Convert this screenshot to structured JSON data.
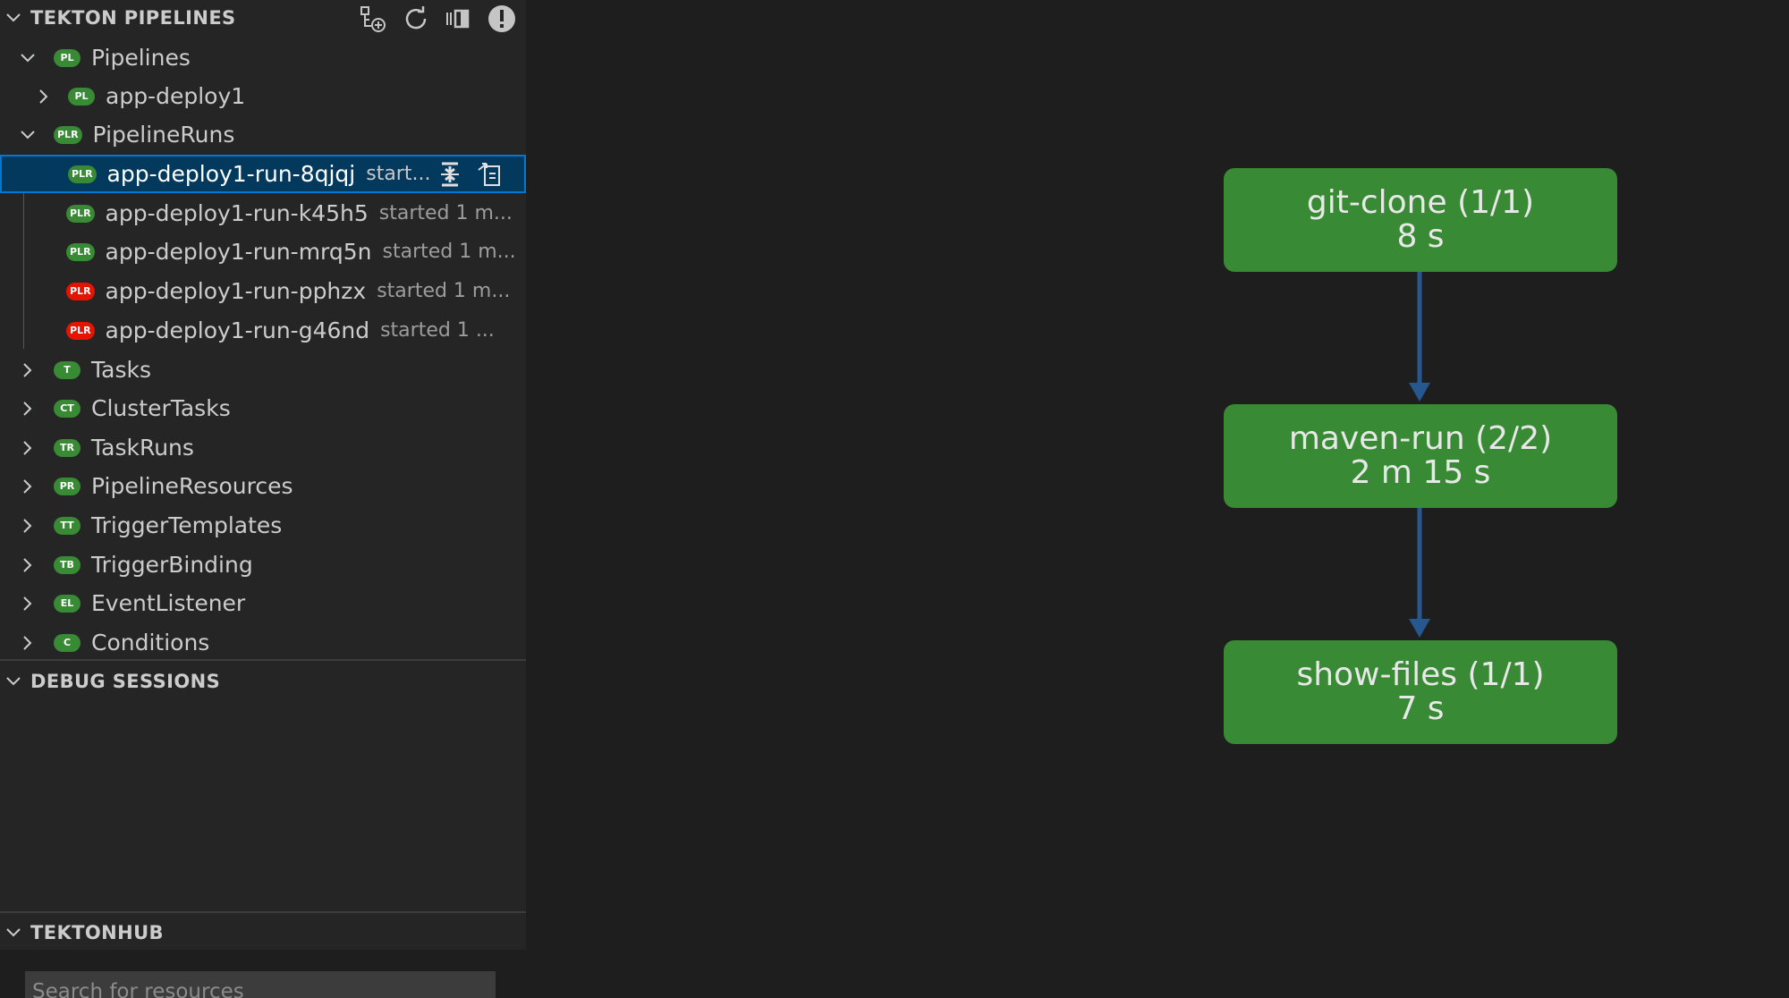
{
  "sidebar": {
    "tekton_header": "TEKTON PIPELINES",
    "header_actions": [
      "add-cluster-icon",
      "refresh-icon",
      "collapse-all-icon",
      "warning-icon"
    ],
    "tree": [
      {
        "label": "Pipelines",
        "badge": "PL",
        "badge_color": "#388a34",
        "expanded": true
      },
      {
        "label": "app-deploy1",
        "badge": "PL",
        "badge_color": "#388a34",
        "expanded": false
      },
      {
        "label": "PipelineRuns",
        "badge": "PLR",
        "badge_color": "#388a34",
        "expanded": true
      },
      {
        "label": "app-deploy1-run-8qjqj",
        "desc": "start...",
        "badge": "PLR",
        "badge_color": "#388a34",
        "selected": true
      },
      {
        "label": "app-deploy1-run-k45h5",
        "desc": "started 1 m...",
        "badge": "PLR",
        "badge_color": "#388a34"
      },
      {
        "label": "app-deploy1-run-mrq5n",
        "desc": "started 1 m...",
        "badge": "PLR",
        "badge_color": "#388a34"
      },
      {
        "label": "app-deploy1-run-pphzx",
        "desc": "started 1 m...",
        "badge": "PLR",
        "badge_color": "#e51400"
      },
      {
        "label": "app-deploy1-run-g46nd",
        "desc": "started 1 ...",
        "badge": "PLR",
        "badge_color": "#e51400"
      },
      {
        "label": "Tasks",
        "badge": "T",
        "badge_color": "#388a34",
        "expanded": false
      },
      {
        "label": "ClusterTasks",
        "badge": "CT",
        "badge_color": "#388a34",
        "expanded": false
      },
      {
        "label": "TaskRuns",
        "badge": "TR",
        "badge_color": "#388a34",
        "expanded": false
      },
      {
        "label": "PipelineResources",
        "badge": "PR",
        "badge_color": "#388a34",
        "expanded": false
      },
      {
        "label": "TriggerTemplates",
        "badge": "TT",
        "badge_color": "#388a34",
        "expanded": false
      },
      {
        "label": "TriggerBinding",
        "badge": "TB",
        "badge_color": "#388a34",
        "expanded": false
      },
      {
        "label": "EventListener",
        "badge": "EL",
        "badge_color": "#388a34",
        "expanded": false
      },
      {
        "label": "Conditions",
        "badge": "C",
        "badge_color": "#388a34",
        "expanded": false
      }
    ],
    "selected_row_actions": [
      "show-logs-icon",
      "open-in-editor-icon"
    ],
    "debug_header": "DEBUG SESSIONS",
    "hub_header": "TEKTONHUB",
    "hub_search_placeholder": "Search for resources"
  },
  "graph": {
    "nodes": [
      {
        "name": "git-clone (1/1)",
        "time": "8 s",
        "status_color": "#388a34"
      },
      {
        "name": "maven-run (2/2)",
        "time": "2 m 15 s",
        "status_color": "#388a34"
      },
      {
        "name": "show-files (1/1)",
        "time": "7 s",
        "status_color": "#388a34"
      }
    ],
    "edge_color": "#26578f"
  }
}
